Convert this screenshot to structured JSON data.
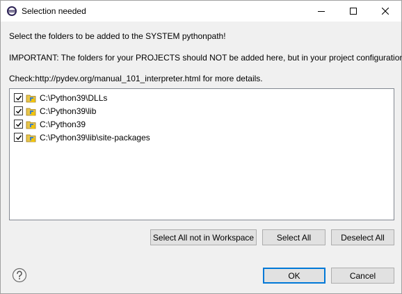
{
  "window": {
    "title": "Selection needed",
    "app_icon": "eclipse-icon",
    "controls": {
      "minimize": "minimize-icon",
      "maximize": "maximize-icon",
      "close": "close-icon"
    }
  },
  "messages": {
    "line1": "Select the folders to be added to the SYSTEM pythonpath!",
    "line2": "IMPORTANT: The folders for your PROJECTS should NOT be added here, but in your project configuration.",
    "line3": "Check:http://pydev.org/manual_101_interpreter.html for more details."
  },
  "folders": {
    "items": [
      {
        "label": "C:\\Python39\\DLLs",
        "checked": true,
        "icon": "folder-package-icon"
      },
      {
        "label": "C:\\Python39\\lib",
        "checked": true,
        "icon": "folder-package-icon"
      },
      {
        "label": "C:\\Python39",
        "checked": true,
        "icon": "folder-package-icon"
      },
      {
        "label": "C:\\Python39\\lib\\site-packages",
        "checked": true,
        "icon": "folder-package-icon"
      }
    ]
  },
  "buttons": {
    "select_all_not_in_workspace": "Select All not in Workspace",
    "select_all": "Select All",
    "deselect_all": "Deselect All",
    "ok": "OK",
    "cancel": "Cancel"
  },
  "help_icon": "question-mark-icon"
}
